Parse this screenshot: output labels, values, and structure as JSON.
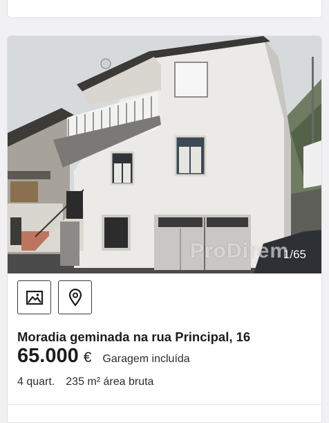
{
  "listing": {
    "photo_counter": "1/65",
    "watermark": "ProDirem",
    "actions": [
      {
        "icon": "image-icon",
        "label": ""
      },
      {
        "icon": "map-pin-icon",
        "label": ""
      }
    ],
    "title": "Moradia geminada na rua Principal, 16",
    "price": "65.000",
    "currency": "€",
    "extra": "Garagem incluída",
    "rooms": "4 quart.",
    "area": "235 m² área bruta"
  },
  "colors": {
    "text": "#1c1c1e",
    "background": "#f1f1f3",
    "card": "#ffffff",
    "border": "#e2e2e6"
  }
}
